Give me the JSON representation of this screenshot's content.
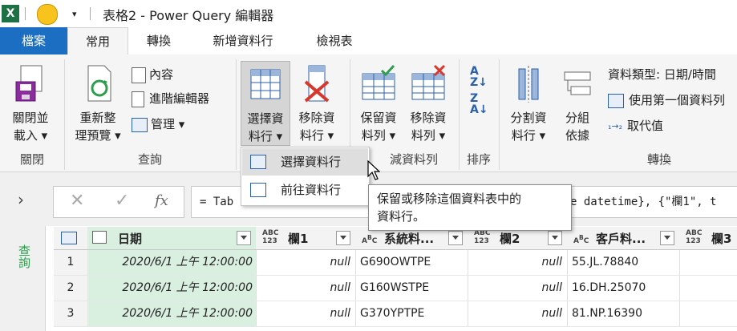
{
  "titlebar": {
    "title": "表格2 - Power Query 編輯器",
    "app_icon": "excel-icon",
    "face_icon": "smiley-icon"
  },
  "tabs": [
    {
      "label": "檔案"
    },
    {
      "label": "常用"
    },
    {
      "label": "轉換"
    },
    {
      "label": "新增資料行"
    },
    {
      "label": "檢視表"
    }
  ],
  "ribbon": {
    "close_load": "關閉並\n載入 ▾",
    "refresh": "重新整\n理預覽 ▾",
    "properties": "內容",
    "advanced_editor": "進階編輯器",
    "manage": "管理 ▾",
    "choose_columns": "選擇資\n料行 ▾",
    "remove_columns": "移除資\n料行 ▾",
    "keep_rows": "保留資\n料列 ▾",
    "remove_rows": "移除資\n料列 ▾",
    "split_column": "分割資\n料行 ▾",
    "group_by": "分組\n依據",
    "data_type": "資料類型: 日期/時間",
    "use_first_row": "使用第一個資料列",
    "replace_values": "取代值",
    "groups": {
      "close": "關閉",
      "query": "查詢",
      "reduce_rows": "減資料列",
      "sort": "排序",
      "transform": "轉換"
    }
  },
  "menu": {
    "items": [
      {
        "label": "選擇資料行"
      },
      {
        "label": "前往資料行"
      }
    ]
  },
  "tooltip": {
    "text": "保留或移除這個資料表中的\n資料行。"
  },
  "sidebar": {
    "label": "查詢"
  },
  "formula": {
    "text": "= Tab",
    "text_right": "e datetime}, {\"欄1\", t",
    "fx": "fx"
  },
  "grid": {
    "columns": [
      {
        "name": "日期",
        "type": "datetime"
      },
      {
        "name": "欄1",
        "type": "ABC\n123"
      },
      {
        "name": "系統料...",
        "type": "ABC"
      },
      {
        "name": "欄2",
        "type": "ABC\n123"
      },
      {
        "name": "客戶料...",
        "type": "ABC"
      },
      {
        "name": "欄3",
        "type": "ABC\n123"
      }
    ],
    "rows": [
      {
        "num": "1",
        "date": "2020/6/1 上午 12:00:00",
        "c1": "null",
        "c2": "G690OWTPE",
        "c3": "null",
        "c4": "55.JL.78840"
      },
      {
        "num": "2",
        "date": "2020/6/1 上午 12:00:00",
        "c1": "null",
        "c2": "G160WSTPE",
        "c3": "null",
        "c4": "16.DH.25070"
      },
      {
        "num": "3",
        "date": "2020/6/1 上午 12:00:00",
        "c1": "null",
        "c2": "G370YPTPE",
        "c3": "null",
        "c4": "81.NP.16390"
      }
    ]
  },
  "colors": {
    "file_tab": "#1b6ec2",
    "date_column": "#d9efdf",
    "accent_green": "#2e9e4e",
    "remove_red": "#d9372b"
  }
}
